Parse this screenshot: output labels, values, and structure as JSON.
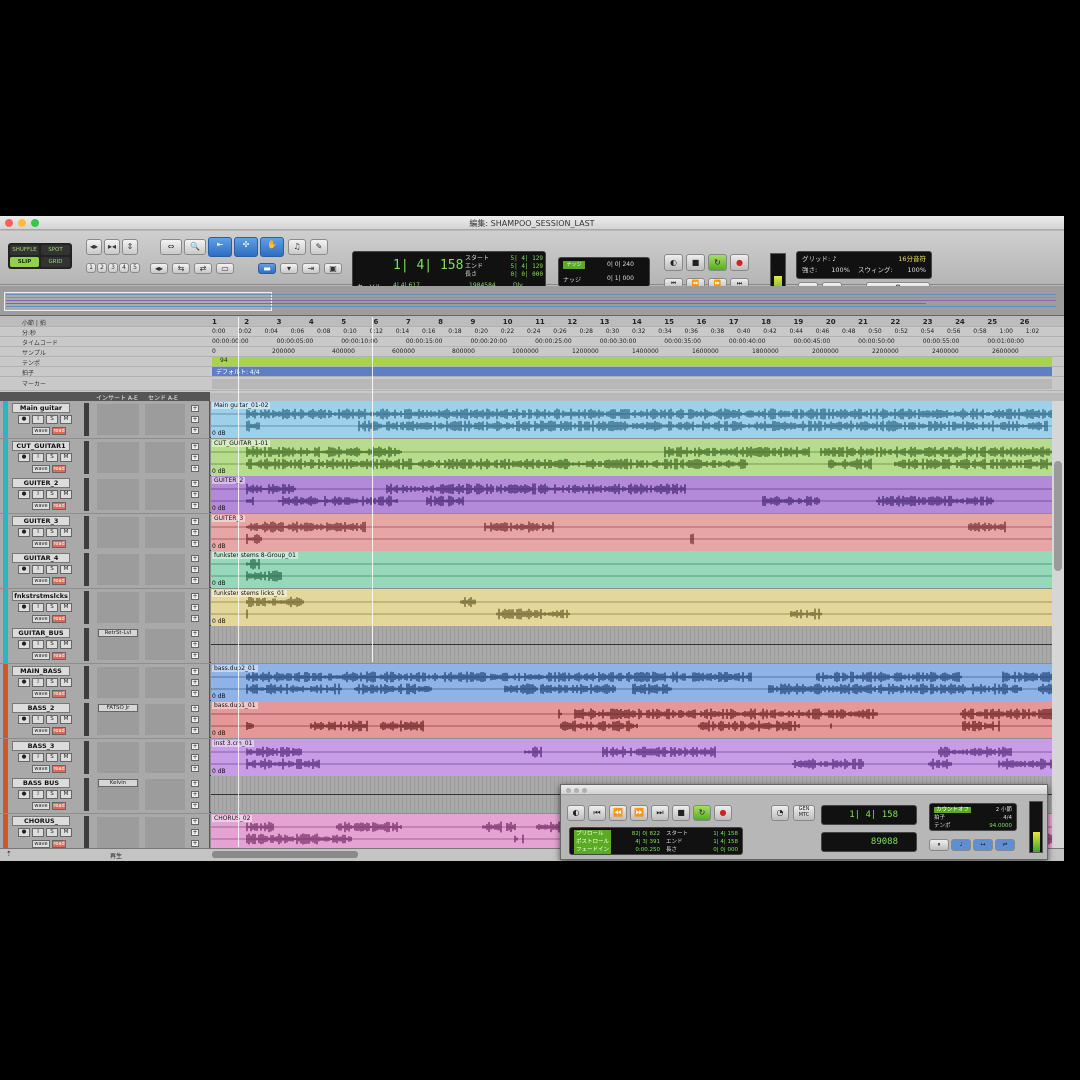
{
  "window": {
    "title": "編集: SHAMPOO_SESSION_LAST"
  },
  "modes": [
    "SHUFFLE",
    "SPOT",
    "SLIP",
    "GRID"
  ],
  "tool_numbers": [
    "1",
    "2",
    "3",
    "4",
    "5"
  ],
  "counter": {
    "main": "1| 4| 158",
    "labels": [
      "スタート",
      "エンド",
      "長さ"
    ],
    "values": [
      "5| 4| 129",
      "5| 4| 129",
      "0| 0| 000"
    ],
    "cursor_label": "カーソル",
    "cursor_value": "4| 4| 617",
    "sample": "1984584",
    "dly": "Dly"
  },
  "nudge": {
    "label1": "ナッジ",
    "value1": "0| 0| 240",
    "label2": "ナッジ",
    "value2": "0| 1| 000"
  },
  "grid_panel": {
    "grid_label": "グリッド:",
    "grid_value": "16分音符",
    "strength_label": "強さ:",
    "strength_value": "100%",
    "swing_label": "スウィング:",
    "swing_value": "100%"
  },
  "ruler": {
    "labels": [
      "小節 | 拍",
      "分:秒",
      "タイムコード",
      "サンプル",
      "テンポ",
      "拍子",
      "マーカー"
    ],
    "bars": [
      "1",
      "2",
      "3",
      "4",
      "5",
      "6",
      "7",
      "8",
      "9",
      "10",
      "11",
      "12",
      "13",
      "14",
      "15",
      "16",
      "17",
      "18",
      "19",
      "20",
      "21",
      "22",
      "23",
      "24",
      "25",
      "26"
    ],
    "minsec": [
      "0:00",
      "0:02",
      "0:04",
      "0:06",
      "0:08",
      "0:10",
      "0:12",
      "0:14",
      "0:16",
      "0:18",
      "0:20",
      "0:22",
      "0:24",
      "0:26",
      "0:28",
      "0:30",
      "0:32",
      "0:34",
      "0:36",
      "0:38",
      "0:40",
      "0:42",
      "0:44",
      "0:46",
      "0:48",
      "0:50",
      "0:52",
      "0:54",
      "0:56",
      "0:58",
      "1:00",
      "1:02"
    ],
    "timecode": [
      "00:00:00:00",
      "00:00:05:00",
      "00:00:10:00",
      "00:00:15:00",
      "00:00:20:00",
      "00:00:25:00",
      "00:00:30:00",
      "00:00:35:00",
      "00:00:40:00",
      "00:00:45:00",
      "00:00:50:00",
      "00:00:55:00",
      "00:01:00:00"
    ],
    "samples": [
      "0",
      "200000",
      "400000",
      "600000",
      "800000",
      "1000000",
      "1200000",
      "1400000",
      "1600000",
      "1800000",
      "2000000",
      "2200000",
      "2400000",
      "2600000"
    ],
    "tempo": "94",
    "meter": "デフォルト: 4/4"
  },
  "track_header": {
    "insert": "インサート A-E",
    "send": "センド A-E"
  },
  "tracks": [
    {
      "name": "Main guitar",
      "clip": "Main guitar_01-02",
      "db": "0 dB",
      "color": "#9fd0ea",
      "wave": "#1f5a7a",
      "side": "#2bb3c9",
      "plugin": "",
      "density": 0.95
    },
    {
      "name": "CUT_GUITAR1",
      "clip": "CUT_GUITAR_1-01",
      "db": "0 dB",
      "color": "#b7dc8b",
      "wave": "#2f5a17",
      "side": "#2bb3c9",
      "plugin": "",
      "density": 0.8
    },
    {
      "name": "GUITER_2",
      "clip": "GUITER_2",
      "db": "0 dB",
      "color": "#b28ad9",
      "wave": "#3c1d68",
      "side": "#2bb3c9",
      "plugin": "",
      "density": 0.6
    },
    {
      "name": "GUITER_3",
      "clip": "GUITER_3",
      "db": "0 dB",
      "color": "#e7a5a5",
      "wave": "#6b2020",
      "side": "#2bb3c9",
      "plugin": "",
      "density": 0.05
    },
    {
      "name": "GUITAR_4",
      "clip": "funkster stems 8-Group_01",
      "db": "0 dB",
      "color": "#97d8b9",
      "wave": "#1e5b40",
      "side": "#2bb3c9",
      "plugin": "",
      "density": 0.05
    },
    {
      "name": "fnkstrstmslcks",
      "clip": "funkster stems licks_01",
      "db": "0 dB",
      "color": "#e3d79a",
      "wave": "#5b5220",
      "side": "#2bb3c9",
      "plugin": "",
      "density": 0.08
    },
    {
      "name": "GUITAR_BUS",
      "clip": "",
      "db": "",
      "color": "#a3a3a3",
      "wave": "#444444",
      "side": "#2bb3c9",
      "plugin": "RetrSt-Lvl",
      "density": 0
    },
    {
      "name": "MAIN_BASS",
      "clip": "bass.dup2_01",
      "db": "0 dB",
      "color": "#8fb3e6",
      "wave": "#17366b",
      "side": "#c9582b",
      "plugin": "",
      "density": 0.7
    },
    {
      "name": "BASS_2",
      "clip": "bass.dup1_01",
      "db": "0 dB",
      "color": "#e69797",
      "wave": "#5b1414",
      "side": "#c9582b",
      "plugin": "FATSO Jr",
      "density": 0.35
    },
    {
      "name": "BASS_3",
      "clip": "inst 3.cm_01",
      "db": "0 dB",
      "color": "#c79de6",
      "wave": "#4a1b70",
      "side": "#c9582b",
      "plugin": "",
      "density": 0.35
    },
    {
      "name": "BASS BUS",
      "clip": "",
      "db": "",
      "color": "#a3a3a3",
      "wave": "#444444",
      "side": "#c9582b",
      "plugin": "Kelvin",
      "density": 0
    },
    {
      "name": "CHORUS_",
      "clip": "CHORUS_02",
      "db": "",
      "color": "#e4a3d3",
      "wave": "#6a1f5a",
      "side": "#c9582b",
      "plugin": "",
      "density": 0.3
    }
  ],
  "track_button_labels": [
    "S",
    "M",
    "wave",
    "read",
    "vol",
    "dyn",
    "ボリューム"
  ],
  "status": {
    "play_label": "再生"
  },
  "transport": {
    "pre_labels": [
      "プリロール",
      "ポストロール",
      "フェードイン"
    ],
    "pre_values": [
      "82| 0| 822",
      "4| 3| 391",
      "0:00.250"
    ],
    "pos_labels": [
      "スタート",
      "エンド",
      "長さ"
    ],
    "pos_values": [
      "1| 4| 158",
      "1| 4| 158",
      "0| 0| 000"
    ],
    "counter_a": "1| 4| 158",
    "counter_b": "89088",
    "gen_label": "GEN MTC",
    "count_label": "カウントオフ",
    "count_value": "2 小節",
    "meter_label": "拍子",
    "meter_value": "4/4",
    "tempo_label": "テンポ",
    "tempo_value": "94.0000"
  }
}
